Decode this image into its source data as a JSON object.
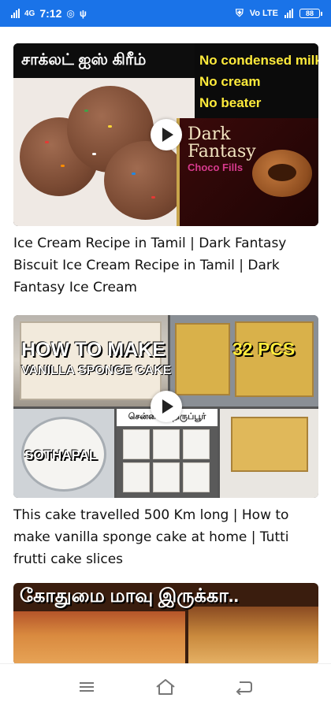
{
  "status_bar": {
    "network_label": "4G",
    "time": "7:12",
    "right_label": "Vo LTE",
    "battery_level": "88"
  },
  "feed": {
    "items": [
      {
        "title": "Ice Cream Recipe in Tamil | Dark Fantasy Biscuit Ice Cream Recipe in Tamil | Dark Fantasy Ice Cream",
        "thumb_text": {
          "tamil_title": "சாக்லட் ஐஸ் கிரீம்",
          "note_1": "No condensed milk",
          "note_2": "No cream",
          "note_3": "No beater",
          "brand_top": "Dark",
          "brand_bottom": "Fantasy",
          "brand_sub": "Choco Fills"
        }
      },
      {
        "title": "This cake travelled 500 Km long | How to make vanilla sponge cake at home | Tutti frutti cake slices",
        "thumb_text": {
          "how_to": "HOW TO MAKE",
          "vanilla": "VANILLA SPONGE CAKE",
          "pcs": "32 PCS",
          "sothapal": "SOTHAPAL",
          "city": "சென்னை - திருப்பூர்"
        }
      },
      {
        "title": "",
        "thumb_text": {
          "tamil_title": "கோதுமை மாவு இருக்கா.."
        }
      }
    ]
  },
  "nav_bar": {
    "menu": "menu-icon",
    "home": "home-icon",
    "back": "back-icon"
  }
}
